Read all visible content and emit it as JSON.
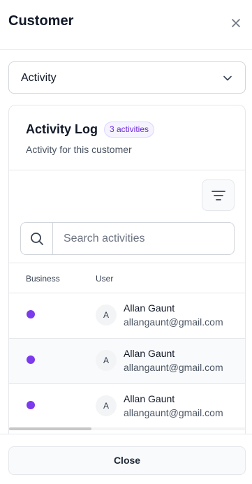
{
  "header": {
    "title": "Customer"
  },
  "view_select": {
    "value": "Activity"
  },
  "activity_log": {
    "title": "Activity Log",
    "badge": "3 activities",
    "subtitle": "Activity for this customer",
    "search": {
      "placeholder": "Search activities"
    },
    "columns": {
      "business": "Business",
      "user": "User"
    },
    "rows": [
      {
        "avatar": "A",
        "name": "Allan Gaunt",
        "email": "allangaunt@gmail.com"
      },
      {
        "avatar": "A",
        "name": "Allan Gaunt",
        "email": "allangaunt@gmail.com"
      },
      {
        "avatar": "A",
        "name": "Allan Gaunt",
        "email": "allangaunt@gmail.com"
      }
    ]
  },
  "footer": {
    "close_label": "Close"
  },
  "colors": {
    "accent": "#7c3aed",
    "badge_bg": "#f5f3ff",
    "border": "#e5e7eb"
  },
  "icons": [
    "close-icon",
    "chevron-down-icon",
    "filter-icon",
    "search-icon"
  ]
}
